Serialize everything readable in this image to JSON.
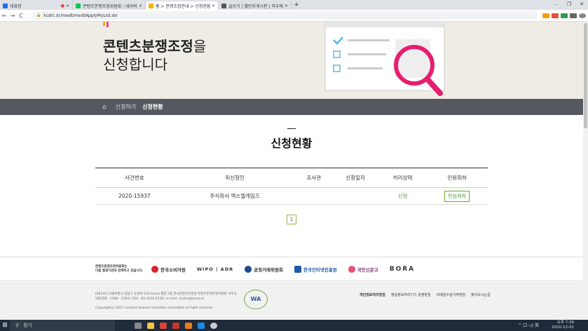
{
  "browser": {
    "tabs": [
      {
        "title": "대화창",
        "color": "#1a73e8"
      },
      {
        "title": "콘텐츠분쟁조정위원회 : 네이버",
        "color": "#03c75a"
      },
      {
        "title": "홈 > 분쟁조정안내 > 신청현황",
        "color": "#f2b705"
      },
      {
        "title": "글쓰기 | 챌린지게시판 | 하우에어",
        "color": "#555555"
      }
    ],
    "url": "kcdrc.kr/medt/medtApplyMyList.do",
    "tab_close": "×",
    "new_tab": "+",
    "win": [
      "–",
      "❐",
      "✕"
    ],
    "nav": [
      "←",
      "→",
      "C"
    ]
  },
  "hero": {
    "title_bold": "콘텐츠분쟁조정",
    "title_light": "을",
    "subtitle": "신청합니다"
  },
  "navbar": {
    "home_icon": "⌂",
    "item1": "신청하기",
    "item2": "신청현황"
  },
  "section": {
    "title": "신청현황"
  },
  "table": {
    "headers": [
      "사건번호",
      "피신청인",
      "조사관",
      "신청일자",
      "처리상태",
      "민원취하"
    ],
    "rows": [
      {
        "case_no": "2020-15937",
        "respondent": "주식회사 엑스엘게임즈",
        "investigator": "",
        "date": "",
        "status": "신청",
        "cancel": "민원취하"
      }
    ]
  },
  "pager": {
    "page": "1"
  },
  "partners": {
    "lead_line1": "콘텐츠분쟁조정위원회는",
    "lead_line2": "다음 협정기관과 연계하고 있습니다.",
    "logos": [
      "한국소비자원",
      "WIPO | ADR",
      "공정거래위원회",
      "한국인터넷진흥원",
      "국민신문고",
      "BORA"
    ]
  },
  "footer": {
    "address": "[06131] 서울특별시 강남구 논현로 535 kocca 별관 2층 한국콘텐츠진흥원 콘텐츠분쟁조정위원회 사무국",
    "phone": "대표전화 : 1588 - 2594 / FAX : 02-2016-4110 / e-mail : kcdrc@kocca.kr",
    "copyright": "Copyright(c) 2017 content dispute resolution committee all right reserved",
    "wa": "WA",
    "links": [
      "개인정보처리방침",
      "영상정보처리기기 운영방침",
      "이메일수집거부방침",
      "찾아오시는길"
    ]
  },
  "taskbar": {
    "start_icon": "⊞",
    "search_placeholder": "찾기",
    "time": "오후 7:39",
    "date": "2020-12-02",
    "tray": "^ 囗 ◁) 英"
  }
}
